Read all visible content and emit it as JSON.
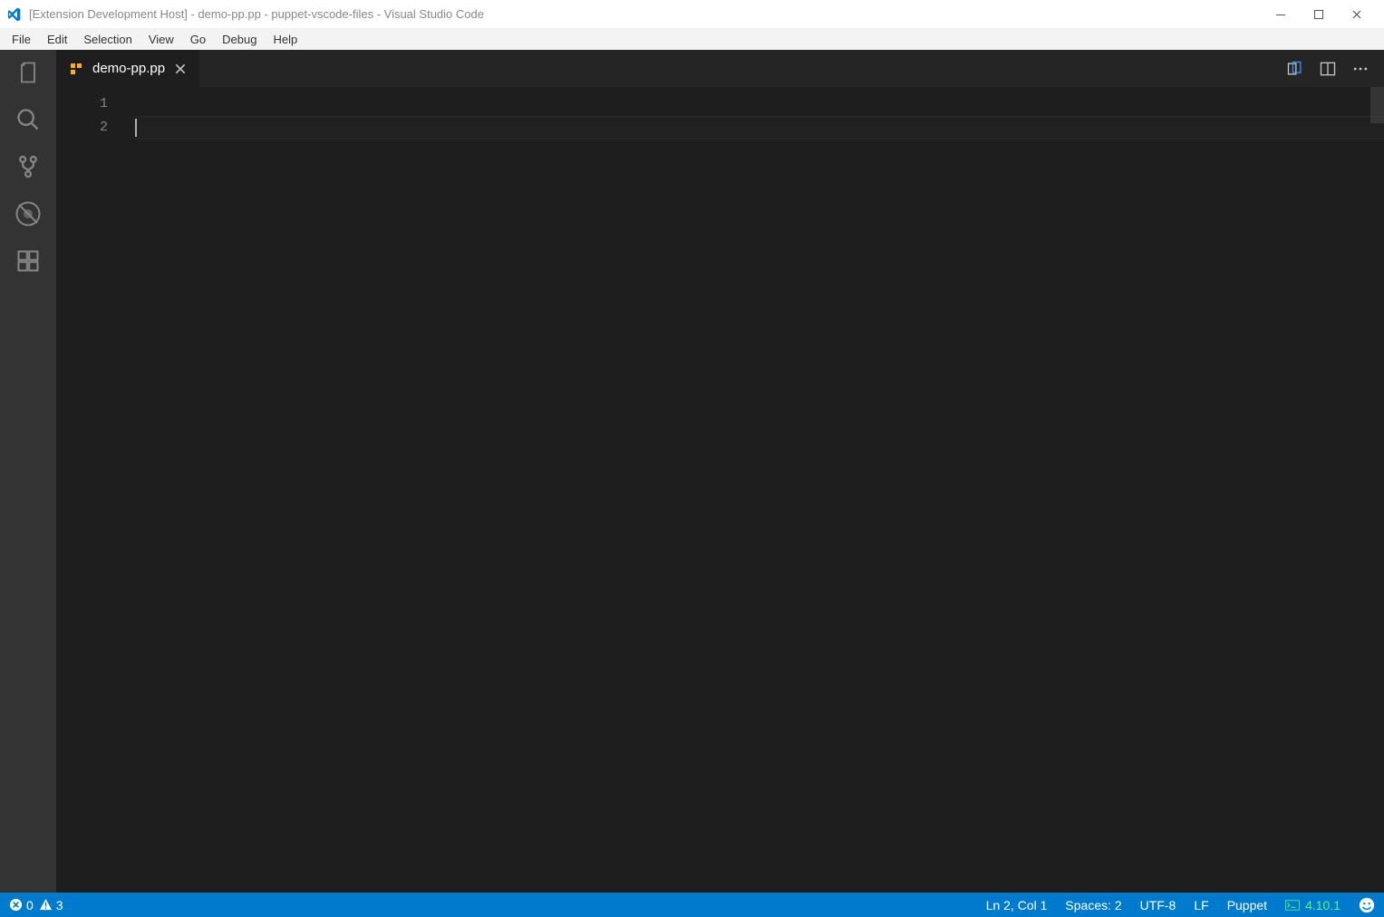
{
  "titlebar": {
    "text": "[Extension Development Host] - demo-pp.pp - puppet-vscode-files - Visual Studio Code"
  },
  "menu": {
    "items": [
      "File",
      "Edit",
      "Selection",
      "View",
      "Go",
      "Debug",
      "Help"
    ]
  },
  "activitybar": {
    "icons": [
      "files-icon",
      "search-icon",
      "source-control-icon",
      "debug-icon",
      "extensions-icon"
    ]
  },
  "tabs": {
    "active": {
      "filename": "demo-pp.pp"
    }
  },
  "editor": {
    "line_numbers": [
      "1",
      "2"
    ],
    "current_line_index": 1
  },
  "statusbar": {
    "errors": "0",
    "warnings": "3",
    "lncol": "Ln 2, Col 1",
    "spaces": "Spaces: 2",
    "encoding": "UTF-8",
    "eol": "LF",
    "language": "Puppet",
    "puppet_version": "4.10.1"
  }
}
